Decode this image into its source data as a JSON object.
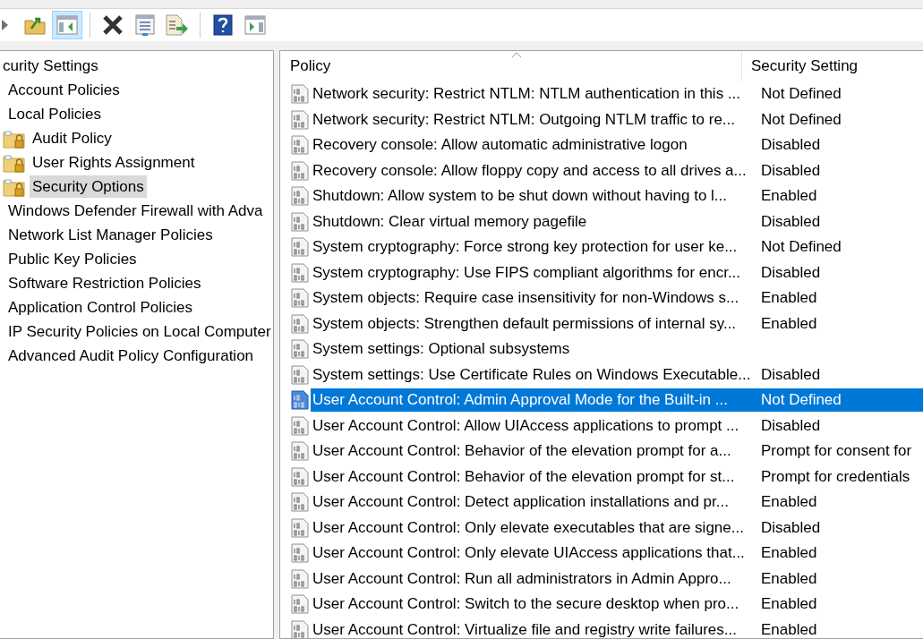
{
  "toolbar": {
    "buttons": [
      {
        "kind": "back",
        "pressed": false
      },
      {
        "kind": "up",
        "pressed": false
      },
      {
        "kind": "tree",
        "pressed": true
      },
      {
        "kind": "sep"
      },
      {
        "kind": "delete",
        "pressed": false
      },
      {
        "kind": "properties",
        "pressed": false
      },
      {
        "kind": "export",
        "pressed": false
      },
      {
        "kind": "sep"
      },
      {
        "kind": "help",
        "pressed": false
      },
      {
        "kind": "actions",
        "pressed": false
      }
    ]
  },
  "tree": {
    "items": [
      {
        "label": "curity Settings",
        "selected": false,
        "children": [
          {
            "label": "Account Policies",
            "selected": false
          },
          {
            "label": "Local Policies",
            "selected": false,
            "children": [
              {
                "label": "Audit Policy",
                "selected": false
              },
              {
                "label": "User Rights Assignment",
                "selected": false
              },
              {
                "label": "Security Options",
                "selected": true
              }
            ]
          },
          {
            "label": "Windows Defender Firewall with Adva",
            "selected": false
          },
          {
            "label": "Network List Manager Policies",
            "selected": false
          },
          {
            "label": "Public Key Policies",
            "selected": false
          },
          {
            "label": "Software Restriction Policies",
            "selected": false
          },
          {
            "label": "Application Control Policies",
            "selected": false
          },
          {
            "label": "IP Security Policies on Local Computer",
            "selected": false
          },
          {
            "label": "Advanced Audit Policy Configuration",
            "selected": false
          }
        ]
      }
    ]
  },
  "table": {
    "columns": [
      "Policy",
      "Security Setting"
    ],
    "rows": [
      {
        "policy": "Network security: Restrict NTLM: NTLM authentication in this ...",
        "setting": "Not Defined",
        "selected": false
      },
      {
        "policy": "Network security: Restrict NTLM: Outgoing NTLM traffic to re...",
        "setting": "Not Defined",
        "selected": false
      },
      {
        "policy": "Recovery console: Allow automatic administrative logon",
        "setting": "Disabled",
        "selected": false
      },
      {
        "policy": "Recovery console: Allow floppy copy and access to all drives a...",
        "setting": "Disabled",
        "selected": false
      },
      {
        "policy": "Shutdown: Allow system to be shut down without having to l...",
        "setting": "Enabled",
        "selected": false
      },
      {
        "policy": "Shutdown: Clear virtual memory pagefile",
        "setting": "Disabled",
        "selected": false
      },
      {
        "policy": "System cryptography: Force strong key protection for user ke...",
        "setting": "Not Defined",
        "selected": false
      },
      {
        "policy": "System cryptography: Use FIPS compliant algorithms for encr...",
        "setting": "Disabled",
        "selected": false
      },
      {
        "policy": "System objects: Require case insensitivity for non-Windows s...",
        "setting": "Enabled",
        "selected": false
      },
      {
        "policy": "System objects: Strengthen default permissions of internal sy...",
        "setting": "Enabled",
        "selected": false
      },
      {
        "policy": "System settings: Optional subsystems",
        "selected": false
      },
      {
        "policy": "System settings: Use Certificate Rules on Windows Executable...",
        "setting": "Disabled",
        "selected": false
      },
      {
        "policy": "User Account Control: Admin Approval Mode for the Built-in ...",
        "setting": "Not Defined",
        "selected": true
      },
      {
        "policy": "User Account Control: Allow UIAccess applications to prompt ...",
        "setting": "Disabled",
        "selected": false
      },
      {
        "policy": "User Account Control: Behavior of the elevation prompt for a...",
        "setting": "Prompt for consent for",
        "selected": false
      },
      {
        "policy": "User Account Control: Behavior of the elevation prompt for st...",
        "setting": "Prompt for credentials",
        "selected": false
      },
      {
        "policy": "User Account Control: Detect application installations and pr...",
        "setting": "Enabled",
        "selected": false
      },
      {
        "policy": "User Account Control: Only elevate executables that are signe...",
        "setting": "Disabled",
        "selected": false
      },
      {
        "policy": "User Account Control: Only elevate UIAccess applications that...",
        "setting": "Enabled",
        "selected": false
      },
      {
        "policy": "User Account Control: Run all administrators in Admin Appro...",
        "setting": "Enabled",
        "selected": false
      },
      {
        "policy": "User Account Control: Switch to the secure desktop when pro...",
        "setting": "Enabled",
        "selected": false
      },
      {
        "policy": "User Account Control: Virtualize file and registry write failures...",
        "setting": "Enabled",
        "selected": false
      }
    ]
  }
}
